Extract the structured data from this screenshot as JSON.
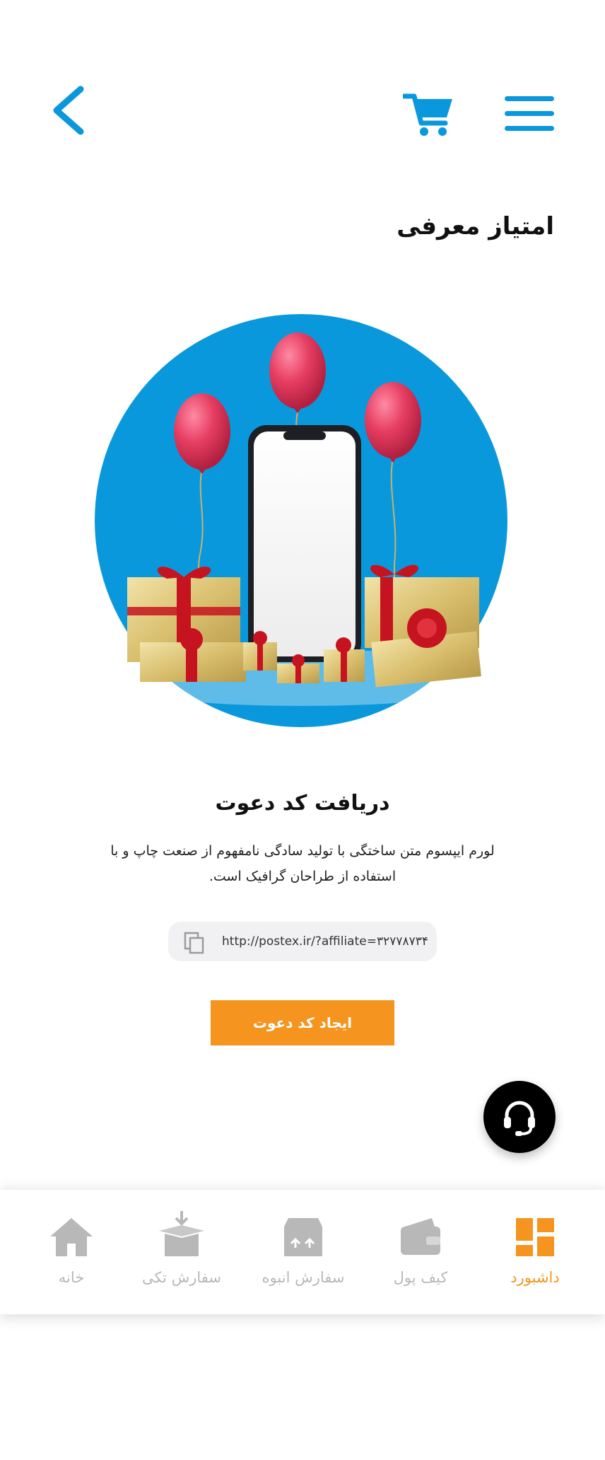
{
  "header": {
    "back_icon": "chevron-left-icon",
    "cart_icon": "cart-icon",
    "menu_icon": "hamburger-menu-icon"
  },
  "page": {
    "title": "امتیاز معرفی"
  },
  "hero": {
    "description_icon": "phone-gifts-balloons-illustration"
  },
  "invite": {
    "title": "دریافت کد دعوت",
    "description_line1": "لورم ایپسوم متن ساختگی با تولید سادگی نامفهوم از صنعت چاپ و با",
    "description_line2": "استفاده از طراحان گرافیک است.",
    "link": "http://postex.ir/?affiliate=۳۲۷۷۸۷۳۴",
    "create_button": "ایجاد کد دعوت"
  },
  "nav": {
    "items": [
      {
        "label": "داشبورد",
        "icon": "dashboard-icon",
        "active": true
      },
      {
        "label": "کیف پول",
        "icon": "wallet-icon",
        "active": false
      },
      {
        "label": "سفارش انبوه",
        "icon": "bulk-order-icon",
        "active": false
      },
      {
        "label": "سفارش تکی",
        "icon": "single-order-icon",
        "active": false
      },
      {
        "label": "خانه",
        "icon": "home-icon",
        "active": false
      }
    ]
  },
  "colors": {
    "accent_blue": "#0a98dc",
    "accent_orange": "#f5941f",
    "nav_inactive": "#b8b8b8"
  }
}
